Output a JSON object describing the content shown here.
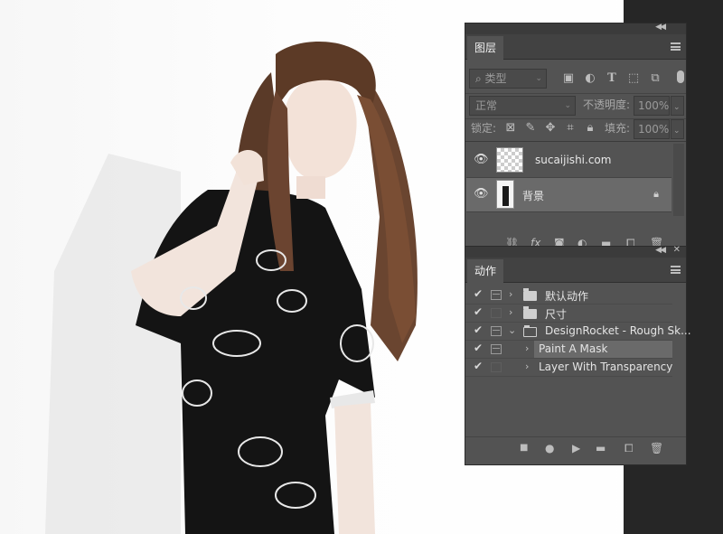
{
  "layers_panel": {
    "tab_label": "图层",
    "filter_kind": "类型",
    "blend_mode": "正常",
    "opacity_label": "不透明度:",
    "opacity_value": "100%",
    "lock_label": "锁定:",
    "fill_label": "填充:",
    "fill_value": "100%",
    "layers": [
      {
        "name": "sucaijishi.com",
        "thumb": "transparent",
        "selected": false,
        "locked": false
      },
      {
        "name": "背景",
        "thumb": "photo",
        "selected": true,
        "locked": true
      }
    ]
  },
  "actions_panel": {
    "tab_label": "动作",
    "rows": [
      {
        "name": "默认动作",
        "level": 0,
        "expanded": false,
        "type": "set",
        "dialog": true,
        "selected": false
      },
      {
        "name": "尺寸",
        "level": 0,
        "expanded": false,
        "type": "set",
        "dialog": false,
        "selected": false
      },
      {
        "name": "DesignRocket - Rough Sk...",
        "level": 0,
        "expanded": true,
        "type": "set",
        "dialog": true,
        "selected": false
      },
      {
        "name": "Paint A Mask",
        "level": 1,
        "expanded": false,
        "type": "action",
        "dialog": true,
        "selected": true
      },
      {
        "name": "Layer With Transparency",
        "level": 1,
        "expanded": false,
        "type": "action",
        "dialog": false,
        "selected": false
      }
    ]
  },
  "colors": {
    "panel_bg": "#535353",
    "selected_row": "#6a6a6a",
    "dark_strip": "#262626"
  },
  "icons": {
    "filter_icons": [
      "image-filter-icon",
      "adjustment-filter-icon",
      "type-filter-icon",
      "shape-filter-icon",
      "smart-object-filter-icon"
    ],
    "lock_icons": [
      "lock-transparent-icon",
      "lock-image-icon",
      "lock-position-icon",
      "lock-artboard-icon",
      "lock-all-icon"
    ],
    "layer_footer": [
      "link-icon",
      "fx-icon",
      "mask-icon",
      "adjustment-icon",
      "group-icon",
      "new-layer-icon",
      "trash-icon"
    ],
    "action_footer": [
      "stop-icon",
      "record-icon",
      "play-icon",
      "new-set-icon",
      "new-action-icon",
      "trash-icon"
    ]
  }
}
